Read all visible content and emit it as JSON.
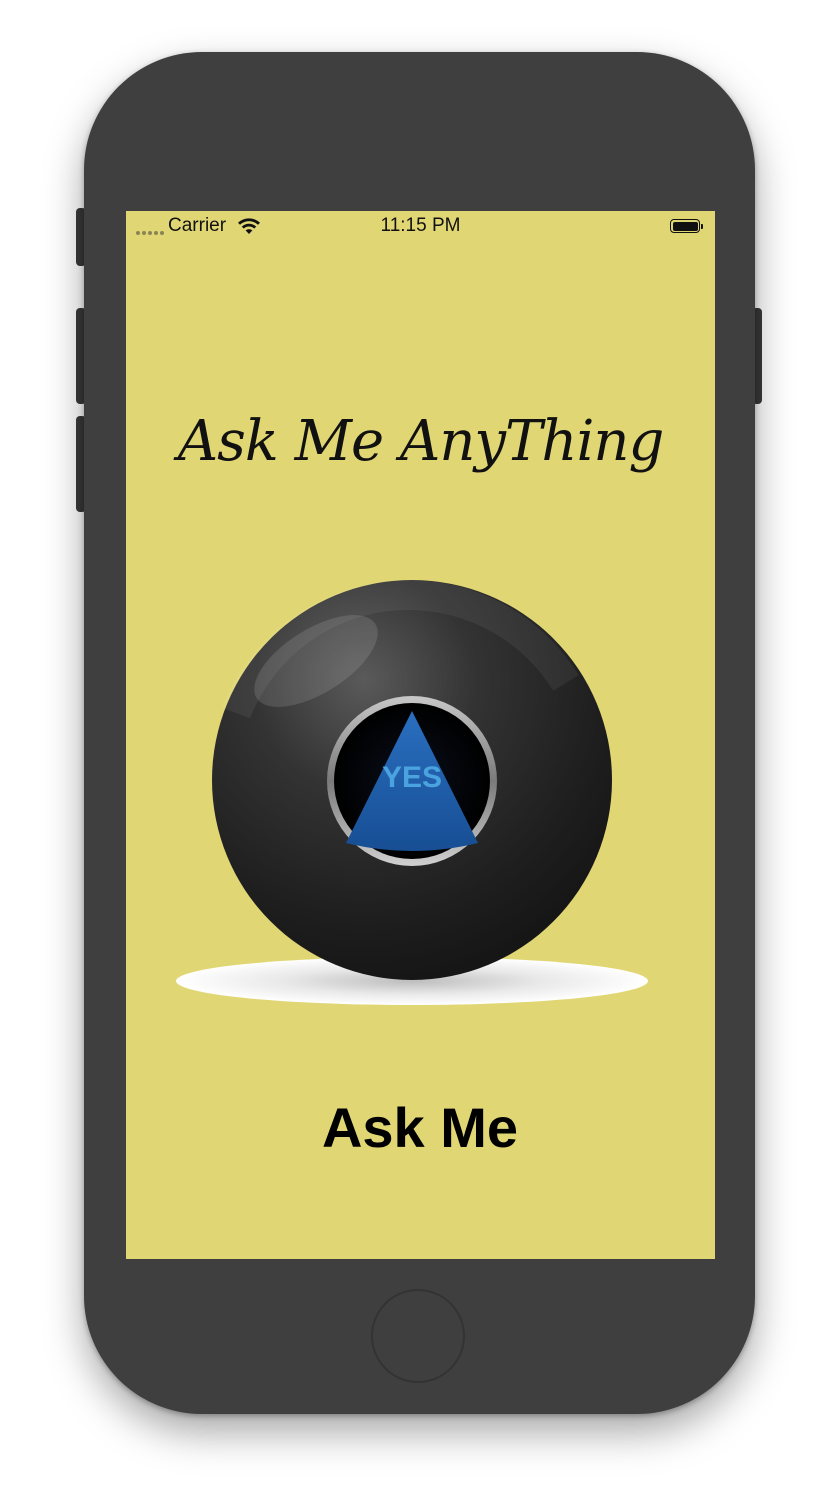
{
  "status_bar": {
    "carrier": "Carrier",
    "time": "11:15 PM",
    "signal_icon": "signal-dots-icon",
    "wifi_icon": "wifi-icon",
    "battery_icon": "battery-icon"
  },
  "main": {
    "title": "Ask Me AnyThing",
    "ball_answer": "YES",
    "ask_button_label": "Ask Me"
  },
  "colors": {
    "screen_background": "#e1d674",
    "phone_body": "#3f3f3f",
    "ball": "#2b2b2b",
    "answer_triangle": "#1d5ea8",
    "answer_text": "#4aa3df"
  }
}
